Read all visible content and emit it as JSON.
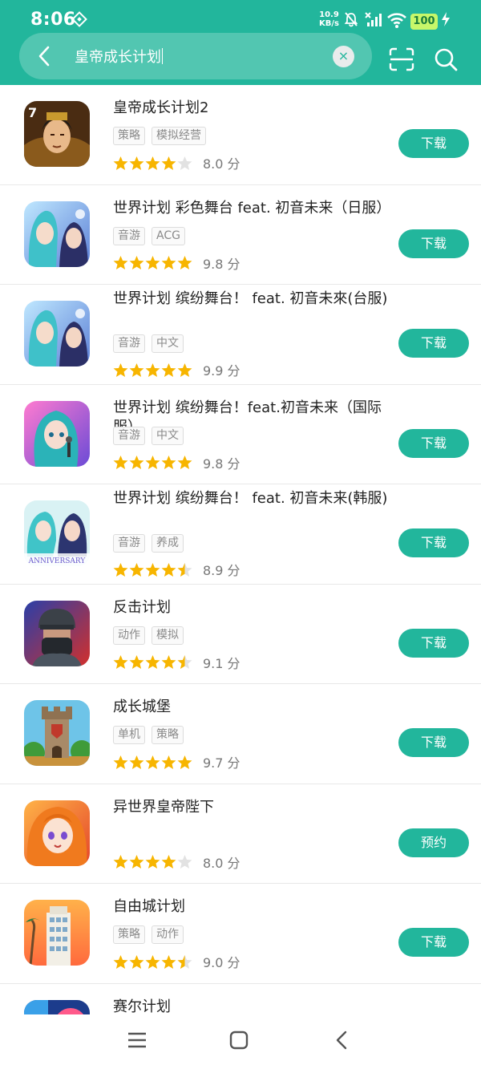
{
  "status_bar": {
    "time": "8:06",
    "net_speed_value": "10.9",
    "net_speed_unit": "KB/s",
    "battery": "100"
  },
  "search": {
    "query": "皇帝成长计划",
    "clear_symbol": "×"
  },
  "apps": [
    {
      "name": "皇帝成长计划2",
      "tags": [
        "策略",
        "模拟经营"
      ],
      "rating": 4,
      "score": "8.0 分",
      "button": "下载",
      "icon": "emperor"
    },
    {
      "name": "世界计划 彩色舞台 feat. 初音未来（日服）",
      "tags": [
        "音游",
        "ACG"
      ],
      "rating": 5,
      "score": "9.8 分",
      "button": "下载",
      "icon": "miku-blue"
    },
    {
      "name": "世界计划 缤纷舞台！ feat. 初音未來(台服)",
      "tags": [
        "音游",
        "中文"
      ],
      "rating": 5,
      "score": "9.9 分",
      "button": "下载",
      "icon": "miku-blue"
    },
    {
      "name": "世界计划 缤纷舞台！feat.初音未来（国际服）",
      "tags": [
        "音游",
        "中文"
      ],
      "rating": 5,
      "score": "9.8 分",
      "button": "下载",
      "icon": "miku-pink"
    },
    {
      "name": "世界计划 缤纷舞台！ feat. 初音未来(韩服)",
      "tags": [
        "音游",
        "养成"
      ],
      "rating": 4.5,
      "score": "8.9 分",
      "button": "下载",
      "icon": "miku-anniv"
    },
    {
      "name": "反击计划",
      "tags": [
        "动作",
        "模拟"
      ],
      "rating": 4.5,
      "score": "9.1 分",
      "button": "下载",
      "icon": "soldier"
    },
    {
      "name": "成长城堡",
      "tags": [
        "单机",
        "策略"
      ],
      "rating": 5,
      "score": "9.7 分",
      "button": "下载",
      "icon": "castle"
    },
    {
      "name": "异世界皇帝陛下",
      "tags": [],
      "rating": 4,
      "score": "8.0 分",
      "button": "预约",
      "icon": "anime-girl"
    },
    {
      "name": "自由城计划",
      "tags": [
        "策略",
        "动作"
      ],
      "rating": 4.5,
      "score": "9.0 分",
      "button": "下载",
      "icon": "city"
    },
    {
      "name": "赛尔计划",
      "tags": [],
      "rating": 0,
      "score": "",
      "button": "",
      "icon": "seer"
    }
  ],
  "colors": {
    "accent": "#22b69c",
    "star": "#f7b500",
    "star_empty": "#e2e2e2"
  }
}
